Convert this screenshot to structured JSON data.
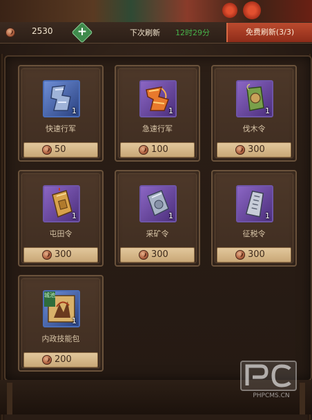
{
  "header": {
    "currency_icon": "copper-coin-icon",
    "currency_amount": "2530",
    "add_button_icon": "plus-icon",
    "refresh_label": "下次刷新",
    "refresh_time": "12时29分",
    "refresh_time_color": "#47b24a",
    "free_refresh_label": "免费刷新(3/3)"
  },
  "shop": {
    "items": [
      {
        "name": "快速行军",
        "quantity": "1",
        "price": "50",
        "price_icon": "copper-coin-icon",
        "icon": "boot-scroll-icon"
      },
      {
        "name": "急速行军",
        "quantity": "1",
        "price": "100",
        "price_icon": "copper-coin-icon",
        "icon": "flaming-boot-icon"
      },
      {
        "name": "伐木令",
        "quantity": "1",
        "price": "300",
        "price_icon": "copper-coin-icon",
        "icon": "wood-token-icon"
      },
      {
        "name": "屯田令",
        "quantity": "1",
        "price": "300",
        "price_icon": "copper-coin-icon",
        "icon": "farm-token-icon"
      },
      {
        "name": "采矿令",
        "quantity": "1",
        "price": "300",
        "price_icon": "copper-coin-icon",
        "icon": "mining-token-icon"
      },
      {
        "name": "征税令",
        "quantity": "1",
        "price": "300",
        "price_icon": "copper-coin-icon",
        "icon": "tax-token-icon"
      },
      {
        "name": "内政技能包",
        "quantity": "1",
        "price": "200",
        "price_icon": "copper-coin-icon",
        "icon": "skill-pack-icon",
        "tag": "城池"
      }
    ]
  },
  "watermark": {
    "logo_text": "PC",
    "text": "PHPCMS.CN"
  },
  "colors": {
    "free_refresh_bg": "#a83b22",
    "price_bar": "#d8bb8a",
    "purple_frame": "#7a55b8",
    "blue_frame": "#4a6db8"
  }
}
